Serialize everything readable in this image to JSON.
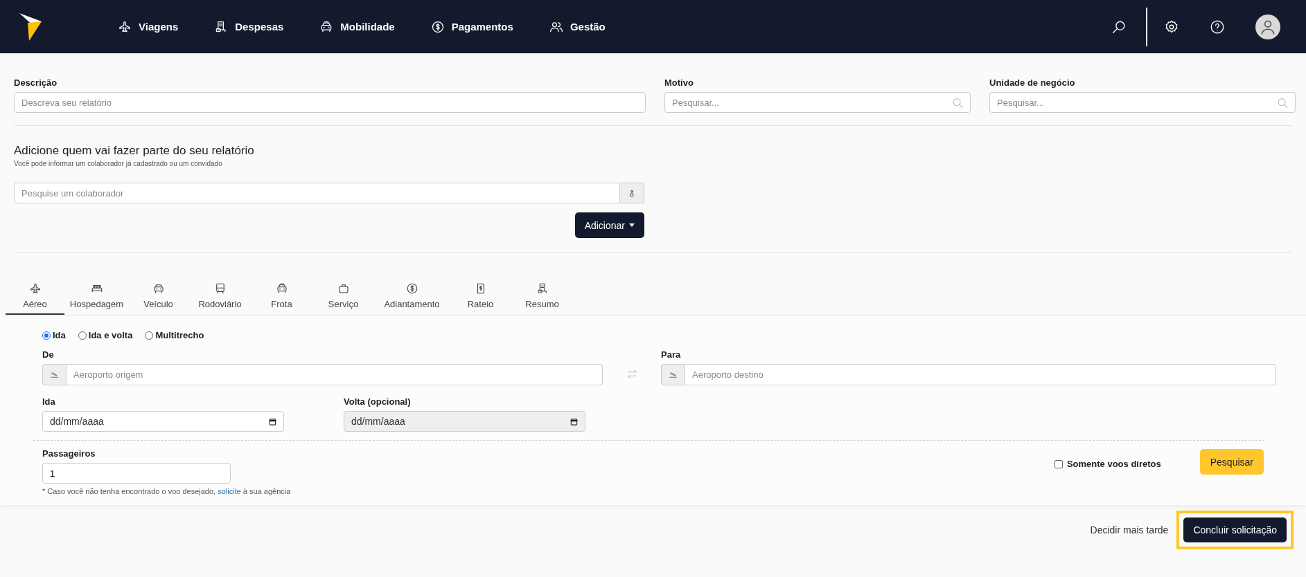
{
  "nav": {
    "items": [
      {
        "label": "Viagens"
      },
      {
        "label": "Despesas"
      },
      {
        "label": "Mobilidade"
      },
      {
        "label": "Pagamentos"
      },
      {
        "label": "Gestão"
      }
    ]
  },
  "report": {
    "description": {
      "label": "Descrição",
      "placeholder": "Descreva seu relatório"
    },
    "reason": {
      "label": "Motivo",
      "placeholder": "Pesquisar..."
    },
    "business_unit": {
      "label": "Unidade de negócio",
      "placeholder": "Pesquisar..."
    }
  },
  "participants": {
    "title": "Adicione quem vai fazer parte do seu relatório",
    "subtitle": "Você pode informar um colaborador já cadastrado ou um convidado",
    "search": {
      "placeholder": "Pesquise um colaborador"
    },
    "add_button": "Adicionar"
  },
  "tabs": [
    {
      "label": "Aéreo",
      "selected": true
    },
    {
      "label": "Hospedagem",
      "selected": false
    },
    {
      "label": "Veículo",
      "selected": false
    },
    {
      "label": "Rodoviário",
      "selected": false
    },
    {
      "label": "Frota",
      "selected": false
    },
    {
      "label": "Serviço",
      "selected": false
    },
    {
      "label": "Adiantamento",
      "selected": false
    },
    {
      "label": "Rateio",
      "selected": false
    },
    {
      "label": "Resumo",
      "selected": false
    }
  ],
  "flight": {
    "trip_types": [
      {
        "label": "Ida",
        "selected": true
      },
      {
        "label": "Ida e volta",
        "selected": false
      },
      {
        "label": "Multitrecho",
        "selected": false
      }
    ],
    "from": {
      "label": "De",
      "placeholder": "Aeroporto origem"
    },
    "to": {
      "label": "Para",
      "placeholder": "Aeroporto destino"
    },
    "departure": {
      "label": "Ida",
      "value": "dd/mm/aaaa",
      "disabled": false
    },
    "return": {
      "label": "Volta (opcional)",
      "value": "dd/mm/aaaa",
      "disabled": true
    },
    "passengers": {
      "label": "Passageiros",
      "value": "1"
    },
    "note": {
      "before": "* Caso você não tenha encontrado o voo desejado, ",
      "link": "solicite",
      "after": " à sua agência"
    },
    "direct_only": {
      "label": "Somente voos diretos",
      "checked": false
    },
    "search_button": "Pesquisar"
  },
  "footer": {
    "later_link": "Decidir mais tarde",
    "submit_button": {
      "label": "Concluir solicitação",
      "highlighted": true
    }
  }
}
